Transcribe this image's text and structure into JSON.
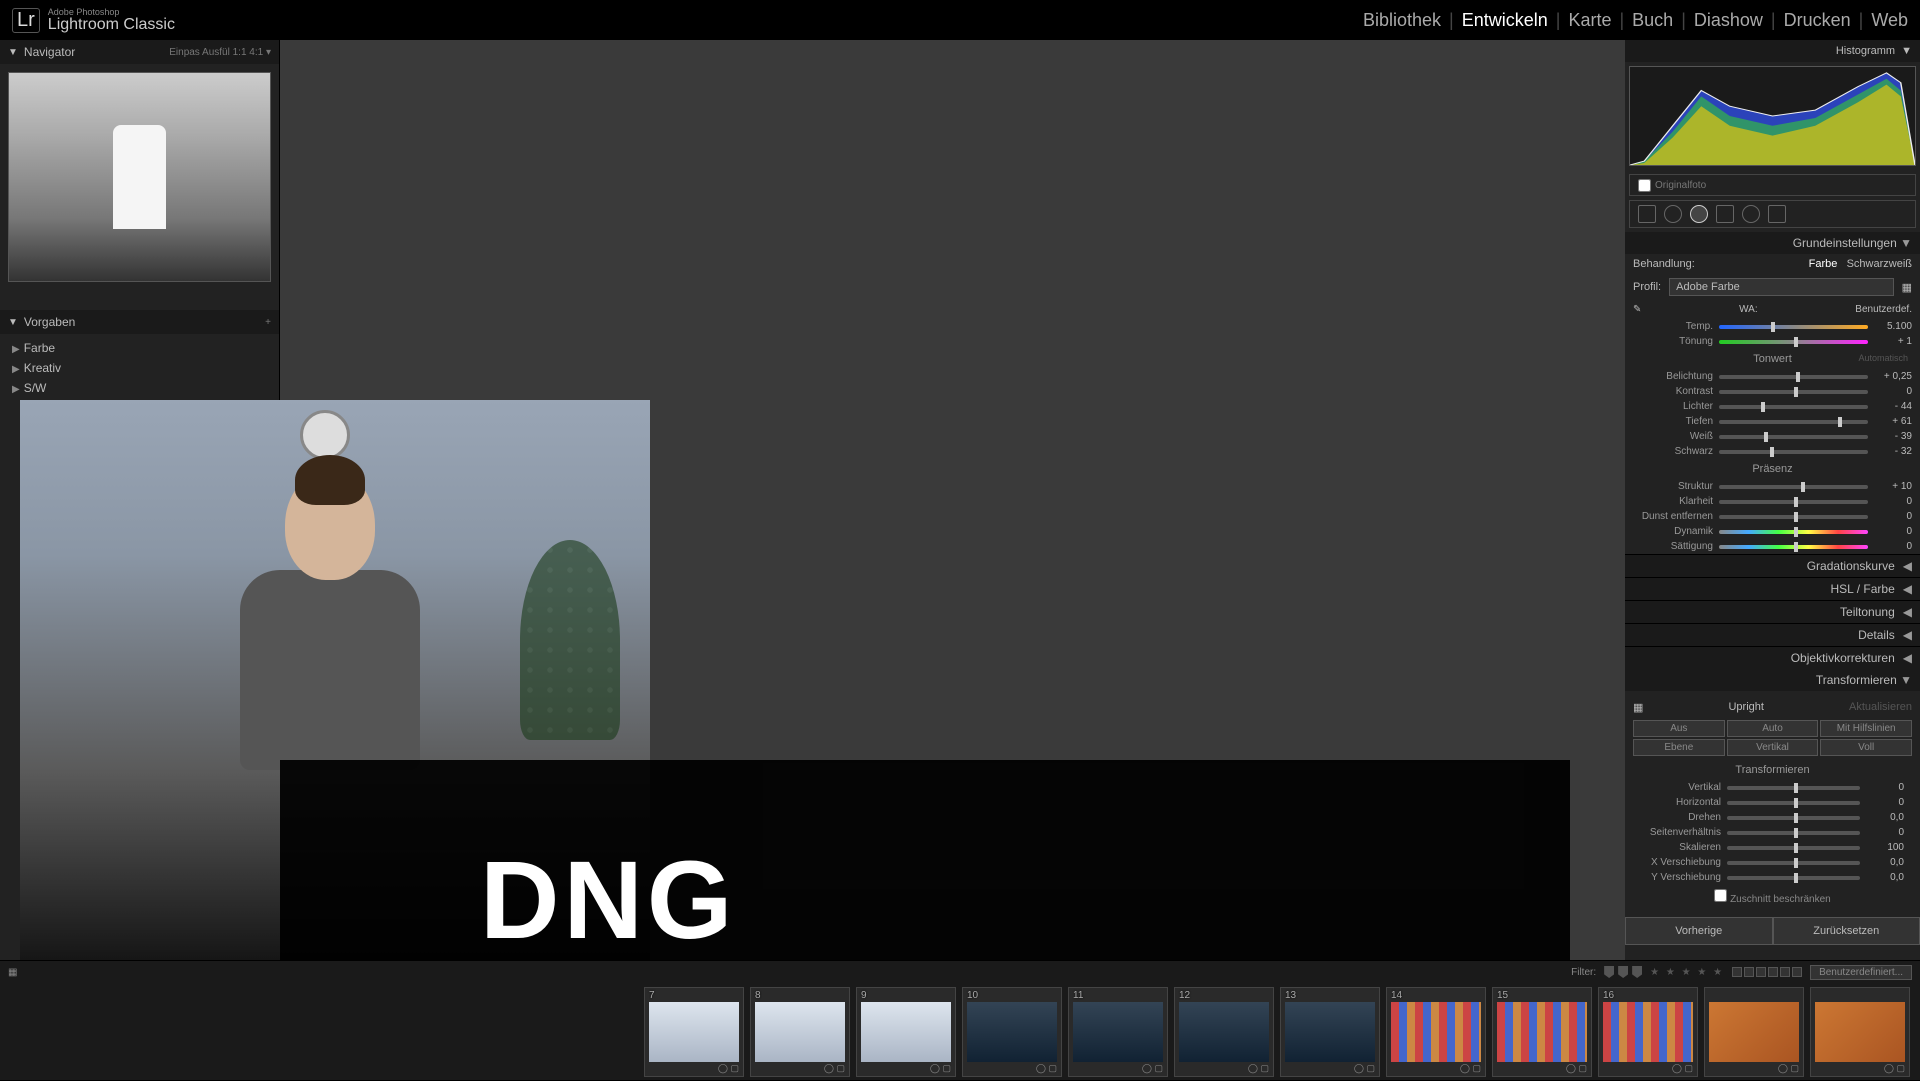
{
  "app": {
    "subtitle": "Adobe Photoshop",
    "title": "Lightroom Classic",
    "logo": "Lr"
  },
  "modules": {
    "items": [
      "Bibliothek",
      "Entwickeln",
      "Karte",
      "Buch",
      "Diashow",
      "Drucken",
      "Web"
    ],
    "active_index": 1
  },
  "left": {
    "navigator": {
      "title": "Navigator",
      "modes": "Einpas   Ausfül   1:1   4:1   ▾"
    },
    "presets": {
      "title": "Vorgaben",
      "groups": [
        "Farbe",
        "Kreativ",
        "S/W"
      ]
    }
  },
  "overlay": {
    "text": "DNG"
  },
  "right": {
    "histogram": {
      "title": "Histogramm"
    },
    "originalfoto": "Originalfoto",
    "basic": {
      "title": "Grundeinstellungen",
      "treatment": {
        "label": "Behandlung:",
        "color": "Farbe",
        "bw": "Schwarzweiß"
      },
      "profile": {
        "label": "Profil:",
        "value": "Adobe Farbe"
      },
      "wb": {
        "label": "WA:",
        "mode": "Benutzerdef."
      },
      "temp": {
        "label": "Temp.",
        "value": "5.100"
      },
      "tint": {
        "label": "Tönung",
        "value": "+ 1"
      },
      "tone_header": "Tonwert",
      "tone_auto": "Automatisch",
      "exposure": {
        "label": "Belichtung",
        "value": "+ 0,25"
      },
      "contrast": {
        "label": "Kontrast",
        "value": "0"
      },
      "highlights": {
        "label": "Lichter",
        "value": "- 44"
      },
      "shadows": {
        "label": "Tiefen",
        "value": "+ 61"
      },
      "whites": {
        "label": "Weiß",
        "value": "- 39"
      },
      "blacks": {
        "label": "Schwarz",
        "value": "- 32"
      },
      "presence_header": "Präsenz",
      "texture": {
        "label": "Struktur",
        "value": "+ 10"
      },
      "clarity": {
        "label": "Klarheit",
        "value": "0"
      },
      "dehaze": {
        "label": "Dunst entfernen",
        "value": "0"
      },
      "vibrance": {
        "label": "Dynamik",
        "value": "0"
      },
      "saturation": {
        "label": "Sättigung",
        "value": "0"
      }
    },
    "panels": {
      "curve": "Gradationskurve",
      "hsl": "HSL / Farbe",
      "split": "Teiltonung",
      "detail": "Details",
      "lens": "Objektivkorrekturen",
      "transform": "Transformieren"
    },
    "transform": {
      "upright_label": "Upright",
      "update": "Aktualisieren",
      "buttons": [
        "Aus",
        "Auto",
        "Mit Hilfslinien",
        "Ebene",
        "Vertikal",
        "Voll"
      ],
      "header": "Transformieren",
      "vertical": {
        "label": "Vertikal",
        "value": "0"
      },
      "horizontal": {
        "label": "Horizontal",
        "value": "0"
      },
      "rotate": {
        "label": "Drehen",
        "value": "0,0"
      },
      "aspect": {
        "label": "Seitenverhältnis",
        "value": "0"
      },
      "scale": {
        "label": "Skalieren",
        "value": "100"
      },
      "xoffset": {
        "label": "X Verschiebung",
        "value": "0,0"
      },
      "yoffset": {
        "label": "Y Verschiebung",
        "value": "0,0"
      },
      "constrain": "Zuschnitt beschränken"
    },
    "buttons": {
      "prev": "Vorherige",
      "reset": "Zurücksetzen"
    }
  },
  "filmstrip": {
    "filter_label": "Filter:",
    "sort": "Benutzerdefiniert...",
    "thumbs": [
      {
        "idx": "7",
        "cls": "light"
      },
      {
        "idx": "8",
        "cls": "light"
      },
      {
        "idx": "9",
        "cls": "light",
        "empty": true
      },
      {
        "idx": "10",
        "cls": "dark",
        "empty": true
      },
      {
        "idx": "11",
        "cls": "dark"
      },
      {
        "idx": "12",
        "cls": "dark"
      },
      {
        "idx": "13",
        "cls": "dark"
      },
      {
        "idx": "14",
        "cls": "containers"
      },
      {
        "idx": "15",
        "cls": "containers"
      },
      {
        "idx": "16",
        "cls": "containers"
      },
      {
        "idx": "",
        "cls": "orange"
      },
      {
        "idx": "",
        "cls": "orange"
      }
    ]
  }
}
